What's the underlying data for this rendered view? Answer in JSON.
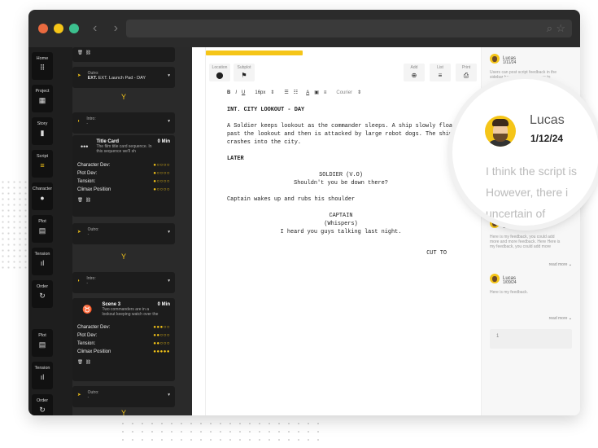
{
  "sidebar_rail": [
    {
      "label": "Home",
      "icon": "grid-icon",
      "glyph": "⠿"
    },
    {
      "label": "Project",
      "icon": "layout-icon",
      "glyph": "▦"
    },
    {
      "label": "Story",
      "icon": "bookmark-icon",
      "glyph": "▮"
    },
    {
      "label": "Script",
      "icon": "lines-icon",
      "glyph": "≡",
      "active": true
    },
    {
      "label": "Character",
      "icon": "person-icon",
      "glyph": "●"
    },
    {
      "label": "Plot",
      "icon": "book-icon",
      "glyph": "▤"
    },
    {
      "label": "Tension",
      "icon": "bars-icon",
      "glyph": "ıl"
    },
    {
      "label": "Order",
      "icon": "cycle-icon",
      "glyph": "↻"
    },
    {
      "label": "Plot",
      "icon": "book-icon",
      "glyph": "▤"
    },
    {
      "label": "Tension",
      "icon": "bars-icon",
      "glyph": "ıl"
    },
    {
      "label": "Order",
      "icon": "cycle-icon",
      "glyph": "↻"
    }
  ],
  "cards": {
    "outro1": {
      "label": "Outro:",
      "value": "EXT. Launch Pad - DAY"
    },
    "intro1": {
      "label": "Intro:",
      "value": "-"
    },
    "title_card": {
      "title": "Title Card",
      "duration": "0 Min",
      "desc1": "The film title card sequence. In",
      "desc2": "this sequence we'll sh"
    },
    "stats1": [
      {
        "label": "Character Dev:",
        "value": "●○○○○"
      },
      {
        "label": "Plot Dev:",
        "value": "●○○○○"
      },
      {
        "label": "Tension:",
        "value": "●○○○○"
      },
      {
        "label": "Climax Position",
        "value": "●○○○○"
      }
    ],
    "outro2": {
      "label": "Outro:",
      "value": "-"
    },
    "intro2": {
      "label": "Intro:",
      "value": "-"
    },
    "scene3": {
      "title": "Scene 3",
      "duration": "0 Min",
      "desc1": "Two commanders are in a",
      "desc2": "lookout keeping watch over the"
    },
    "stats2": [
      {
        "label": "Character Dev:",
        "value": "●●●○○"
      },
      {
        "label": "Plot Dev:",
        "value": "●●○○○"
      },
      {
        "label": "Tension:",
        "value": "●●○○○"
      },
      {
        "label": "Climax Position",
        "value": "●●●●●"
      }
    ],
    "outro3": {
      "label": "Outro:",
      "value": "-"
    }
  },
  "editor": {
    "progress": 0.35,
    "buttons": {
      "location": "Location",
      "subplot": "Subplot",
      "add": "Add",
      "list": "List",
      "print": "Print"
    },
    "format": {
      "bold": "B",
      "italic": "I",
      "underline": "U",
      "size": "16px",
      "font": "Courier"
    },
    "script": {
      "heading": "INT. CITY LOOKOUT - DAY",
      "action1": "A Soldier keeps lookout as the commander sleeps. A ship slowly floats past the lookout and then is attacked by large robot dogs. The ship crashes into the city.",
      "later": "LATER",
      "char1": "SOLDIER (V.O)",
      "dial1": "Shouldn't you be down there?",
      "action2": "Captain wakes up and rubs his shoulder",
      "char2": "CAPTAIN",
      "paren2": "(Whispers)",
      "dial2": "I heard you guys talking last night.",
      "transition": "CUT TO"
    }
  },
  "comments": [
    {
      "name": "Lucas",
      "date": "1/11/24",
      "text1": "Users can post script feedback in the",
      "text2": "sidebar here. This allows users to"
    },
    {
      "name": "Lucas",
      "date": "1/09/24",
      "text1": "Here is my feedback, you could add",
      "text2": "more and more feedback. Here Here is",
      "text3": "my feedback, you could add more",
      "more": "read more"
    },
    {
      "name": "Lucas",
      "date": "1/09/24",
      "text1": "Here is my feedback.",
      "more": "read more"
    }
  ],
  "comment_input": {
    "value": "1"
  },
  "magnifier": {
    "name": "Lucas",
    "date": "1/12/24",
    "line1": "I think the script is",
    "line2": "However, there i",
    "line3": "uncertain of"
  },
  "colors": {
    "accent": "#f5c518",
    "dark": "#1e1e1e"
  }
}
